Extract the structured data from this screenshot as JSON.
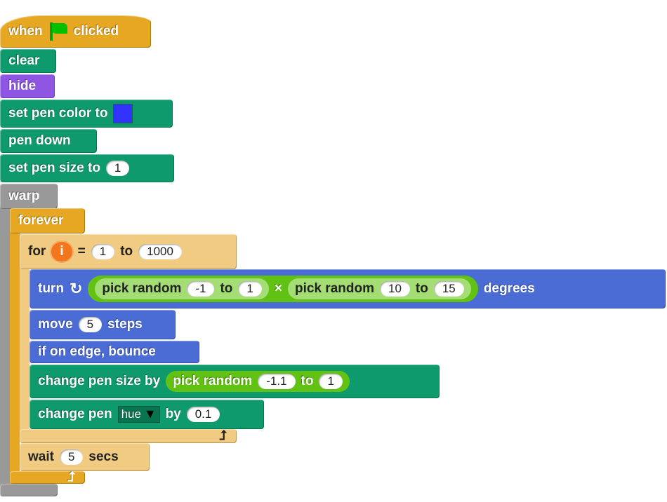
{
  "script": {
    "hat": {
      "when": "when",
      "clicked": "clicked",
      "flag_color": "#00c000"
    },
    "clear": "clear",
    "hide": "hide",
    "set_pen_color": {
      "label": "set pen color to",
      "color": "#3333ff"
    },
    "pen_down": "pen down",
    "set_pen_size": {
      "label": "set pen size to",
      "value": "1"
    },
    "warp": "warp",
    "forever": "forever",
    "for": {
      "label": "for",
      "var": "i",
      "eq": "=",
      "from": "1",
      "to_label": "to",
      "to": "1000"
    },
    "turn": {
      "label": "turn",
      "r1": {
        "label": "pick random",
        "a": "-1",
        "to": "to",
        "b": "1"
      },
      "times": "×",
      "r2": {
        "label": "pick random",
        "a": "10",
        "to": "to",
        "b": "15"
      },
      "degrees": "degrees"
    },
    "move": {
      "label": "move",
      "value": "5",
      "steps": "steps"
    },
    "bounce": "if on edge, bounce",
    "change_pen_size": {
      "label": "change pen size by",
      "r": {
        "label": "pick random",
        "a": "-1.1",
        "to": "to",
        "b": "1"
      }
    },
    "change_pen": {
      "label": "change pen",
      "option": "hue",
      "by": "by",
      "value": "0.1"
    },
    "wait": {
      "label": "wait",
      "value": "5",
      "secs": "secs"
    }
  },
  "colors": {
    "pen": "#0e9a6c",
    "motion": "#4a6cd4",
    "control": "#e6a822",
    "looks": "#8f56e3",
    "operators": "#62c213",
    "other": "#999999"
  }
}
